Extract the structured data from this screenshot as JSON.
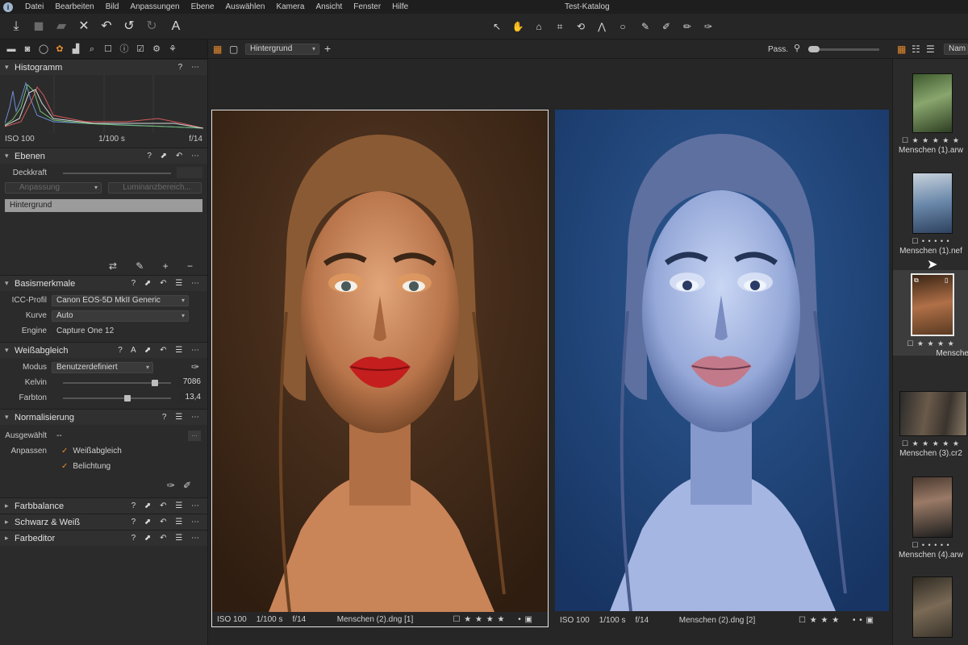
{
  "window": {
    "title": "Test-Katalog"
  },
  "menu": [
    "Datei",
    "Bearbeiten",
    "Bild",
    "Anpassungen",
    "Ebene",
    "Auswählen",
    "Kamera",
    "Ansicht",
    "Fenster",
    "Hilfe"
  ],
  "histogram": {
    "title": "Histogramm",
    "iso": "ISO 100",
    "shutter": "1/100 s",
    "aperture": "f/14"
  },
  "layers": {
    "title": "Ebenen",
    "opacity_label": "Deckkraft",
    "adjust_label": "Anpassung",
    "luminance_label": "Luminanzbereich...",
    "layer_name": "Hintergrund"
  },
  "basic": {
    "title": "Basismerkmale",
    "icc_label": "ICC-Profil",
    "icc_value": "Canon EOS-5D MkII Generic",
    "curve_label": "Kurve",
    "curve_value": "Auto",
    "engine_label": "Engine",
    "engine_value": "Capture One 12"
  },
  "white_balance": {
    "title": "Weißabgleich",
    "mode_label": "Modus",
    "mode_value": "Benutzerdefiniert",
    "kelvin_label": "Kelvin",
    "kelvin_value": "7086",
    "kelvin_level": 0.85,
    "tint_label": "Farbton",
    "tint_value": "13,4",
    "tint_level": 0.6
  },
  "normalize": {
    "title": "Normalisierung",
    "selected_label": "Ausgewählt",
    "selected_value": "--",
    "adjust_label": "Anpassen",
    "wb_option": "Weißabgleich",
    "exposure_option": "Belichtung"
  },
  "collapsed_sections": [
    "Farbbalance",
    "Schwarz & Weiß",
    "Farbeditor"
  ],
  "viewer": {
    "layer_select": "Hintergrund",
    "fit_label": "Pass.",
    "left_photo": {
      "iso": "ISO 100",
      "shutter": "1/100 s",
      "aperture": "f/14",
      "name": "Menschen (2).dng [1]",
      "stars": "★ ★ ★ ★"
    },
    "right_photo": {
      "iso": "ISO 100",
      "shutter": "1/100 s",
      "aperture": "f/14",
      "name": "Menschen (2).dng [2]",
      "stars": "★ ★ ★"
    }
  },
  "browser": {
    "sort_label": "Nam",
    "thumbs": [
      {
        "name": "Menschen (1).arw",
        "stars": "☐ ★ ★ ★ ★ ★"
      },
      {
        "name": "Menschen (1).nef",
        "stars": "☐ • • • • •"
      },
      {
        "name": "Mensche",
        "stars": "☐ ★ ★ ★ ★"
      },
      {
        "name": "Menschen (3).cr2",
        "stars": "☐ ★ ★ ★ ★ ★"
      },
      {
        "name": "Menschen (4).arw",
        "stars": "☐ • • • • •"
      }
    ]
  },
  "colors": {
    "accent": "#e88b2e",
    "panel": "#2b2b2b",
    "background": "#262626"
  }
}
